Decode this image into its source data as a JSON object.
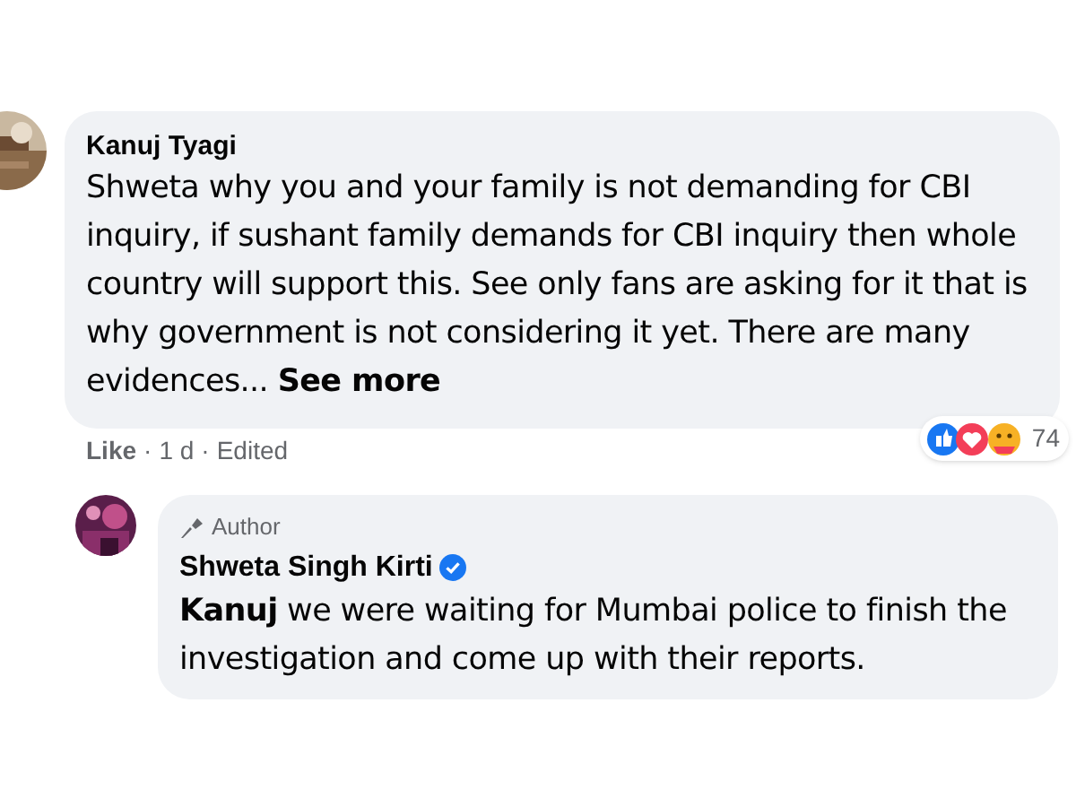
{
  "comment": {
    "author": "Kanuj Tyagi",
    "text": "Shweta why you and your family is not demanding for CBI inquiry, if sushant family demands for CBI inquiry then whole country will support this. See only fans are asking for it that is why government is not considering it yet. There are many evidences...",
    "see_more": "See more",
    "actions": [
      "Like",
      "·",
      "1 d",
      "·",
      "Edited"
    ],
    "reaction_count": "74"
  },
  "reply": {
    "badge": "Author",
    "author": "Shweta Singh Kirti",
    "verified": true,
    "text": "**Kanuj** we were waiting for Mumbai police to finish the investigation and come up with their reports."
  }
}
